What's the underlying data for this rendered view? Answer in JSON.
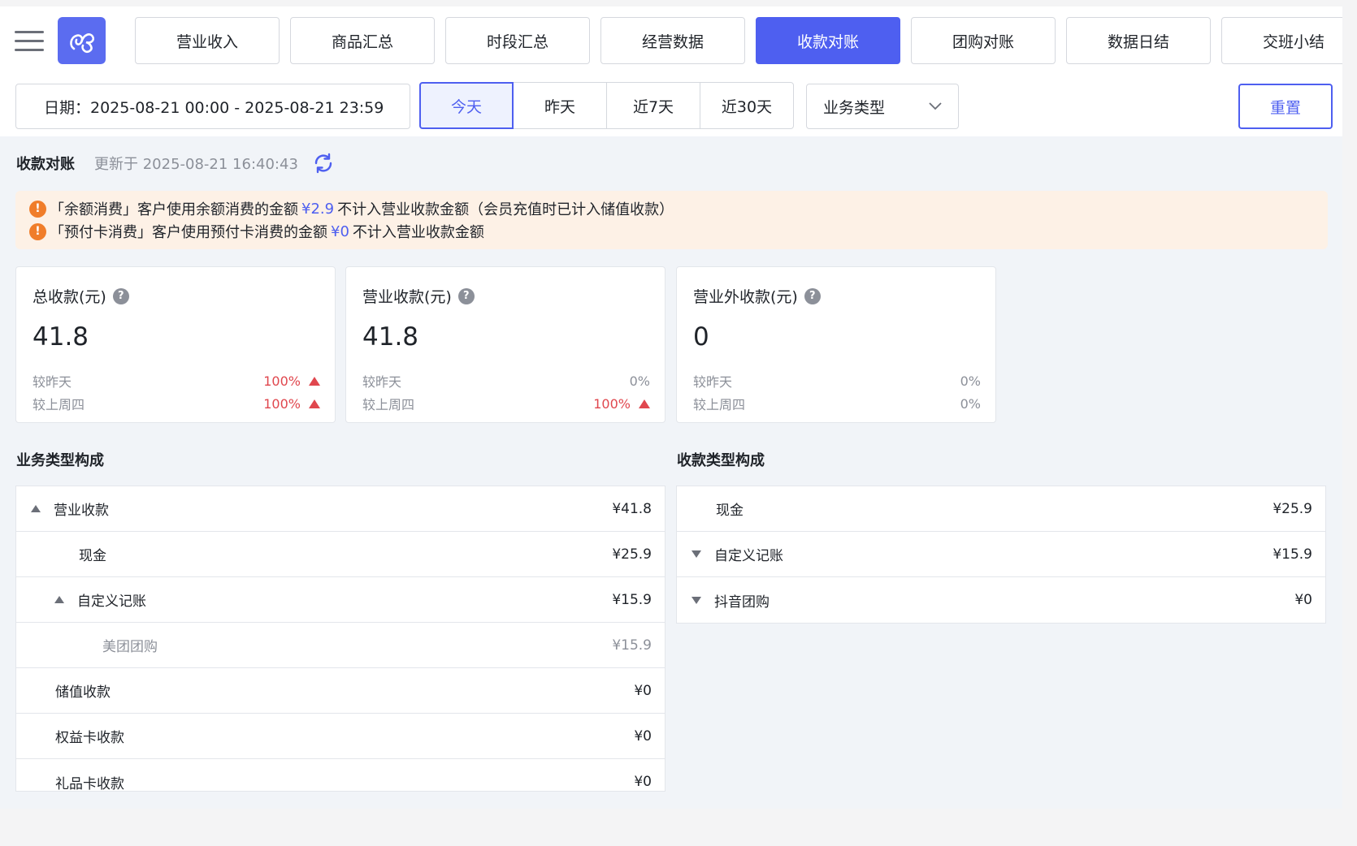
{
  "nav": {
    "tabs": [
      {
        "label": "营业收入"
      },
      {
        "label": "商品汇总"
      },
      {
        "label": "时段汇总"
      },
      {
        "label": "经营数据"
      },
      {
        "label": "收款对账"
      },
      {
        "label": "团购对账"
      },
      {
        "label": "数据日结"
      },
      {
        "label": "交班小结"
      }
    ],
    "active_index": 4
  },
  "filters": {
    "date_range": "日期：2025-08-21 00:00 - 2025-08-21 23:59",
    "quick": [
      "今天",
      "昨天",
      "近7天",
      "近30天"
    ],
    "quick_active": "今天",
    "business_type": "业务类型",
    "reset": "重置"
  },
  "header": {
    "title": "收款对账",
    "updated": "更新于 2025-08-21 16:40:43"
  },
  "notice": {
    "line1": {
      "pre": "「余额消费」客户使用余额消费的金额",
      "amount": "¥2.9",
      "post": "不计入营业收款金额（会员充值时已计入储值收款）"
    },
    "line2": {
      "pre": "「预付卡消费」客户使用预付卡消费的金额",
      "amount": "¥0",
      "post": "不计入营业收款金额"
    }
  },
  "cards": [
    {
      "title": "总收款(元)",
      "value": "41.8",
      "cmp1_label": "较昨天",
      "cmp1_value": "100%",
      "cmp1_up": true,
      "cmp2_label": "较上周四",
      "cmp2_value": "100%",
      "cmp2_up": true
    },
    {
      "title": "营业收款(元)",
      "value": "41.8",
      "cmp1_label": "较昨天",
      "cmp1_value": "0%",
      "cmp1_up": false,
      "cmp2_label": "较上周四",
      "cmp2_value": "100%",
      "cmp2_up": true
    },
    {
      "title": "营业外收款(元)",
      "value": "0",
      "cmp1_label": "较昨天",
      "cmp1_value": "0%",
      "cmp1_up": false,
      "cmp2_label": "较上周四",
      "cmp2_value": "0%",
      "cmp2_up": false
    }
  ],
  "business": {
    "title": "业务类型构成",
    "rows": [
      {
        "label": "营业收款",
        "amount": "¥41.8"
      },
      {
        "label": "现金",
        "amount": "¥25.9"
      },
      {
        "label": "自定义记账",
        "amount": "¥15.9"
      },
      {
        "label": "美团团购",
        "amount": "¥15.9"
      },
      {
        "label": "储值收款",
        "amount": "¥0"
      },
      {
        "label": "权益卡收款",
        "amount": "¥0"
      },
      {
        "label": "礼品卡收款",
        "amount": "¥0"
      }
    ]
  },
  "payment": {
    "title": "收款类型构成",
    "rows": [
      {
        "label": "现金",
        "amount": "¥25.9"
      },
      {
        "label": "自定义记账",
        "amount": "¥15.9"
      },
      {
        "label": "抖音团购",
        "amount": "¥0"
      }
    ]
  },
  "colors": {
    "accent": "#4e5ff0",
    "up": "#e0474e",
    "warning": "#f07d2a",
    "notice_bg": "#fdf1e6"
  }
}
